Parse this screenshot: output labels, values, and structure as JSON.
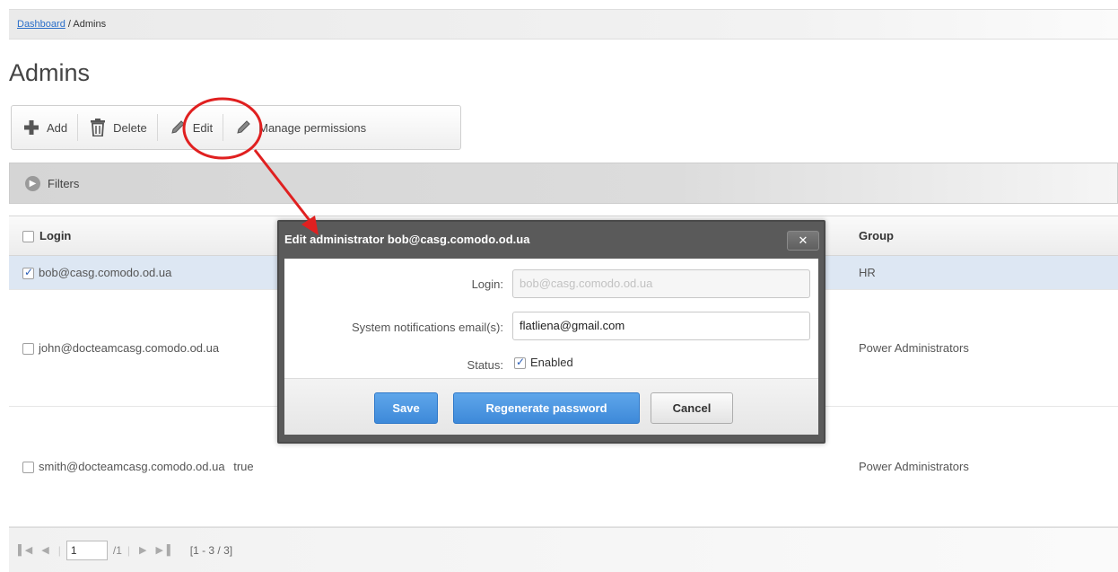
{
  "breadcrumb": {
    "root": "Dashboard",
    "separator": " / ",
    "current": "Admins"
  },
  "page": {
    "title": "Admins"
  },
  "toolbar": {
    "add": "Add",
    "delete": "Delete",
    "edit": "Edit",
    "manage_permissions": "Manage permissions"
  },
  "filters": {
    "label": "Filters"
  },
  "table": {
    "columns": {
      "login": "Login",
      "group": "Group"
    },
    "rows": [
      {
        "login": "bob@casg.comodo.od.ua",
        "status": "",
        "group": "HR",
        "checked": true
      },
      {
        "login": "john@docteamcasg.comodo.od.ua",
        "status": "",
        "group": "Power Administrators",
        "checked": false
      },
      {
        "login": "smith@docteamcasg.comodo.od.ua",
        "status": "true",
        "group": "Power Administrators",
        "checked": false
      }
    ]
  },
  "pager": {
    "page": "1",
    "of_pages": "/1",
    "range": "[1 - 3 / 3]"
  },
  "modal": {
    "title": "Edit administrator bob@casg.comodo.od.ua",
    "close": "✕",
    "login_label": "Login:",
    "login_value": "bob@casg.comodo.od.ua",
    "email_label": "System notifications email(s):",
    "email_value": "flatliena@gmail.com",
    "status_label": "Status:",
    "status_value": "Enabled",
    "save": "Save",
    "regenerate": "Regenerate password",
    "cancel": "Cancel"
  },
  "colors": {
    "accent_blue": "#3d89d9",
    "annotation_red": "#e02020",
    "selected_row": "#dde7f3",
    "modal_frame": "#5a5a5a"
  }
}
